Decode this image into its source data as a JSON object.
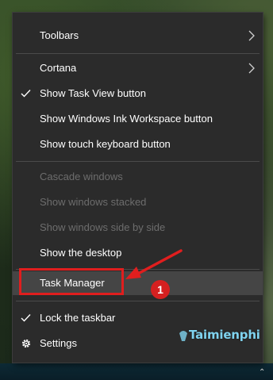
{
  "context_menu": {
    "items": [
      {
        "label": "Toolbars",
        "state": "enabled",
        "has_submenu": true
      },
      {
        "label": "Cortana",
        "state": "enabled",
        "has_submenu": true
      },
      {
        "label": "Show Task View button",
        "state": "enabled",
        "checked": true
      },
      {
        "label": "Show Windows Ink Workspace button",
        "state": "enabled"
      },
      {
        "label": "Show touch keyboard button",
        "state": "enabled"
      },
      {
        "label": "Cascade windows",
        "state": "disabled"
      },
      {
        "label": "Show windows stacked",
        "state": "disabled"
      },
      {
        "label": "Show windows side by side",
        "state": "disabled"
      },
      {
        "label": "Show the desktop",
        "state": "enabled"
      },
      {
        "label": "Task Manager",
        "state": "hovered"
      },
      {
        "label": "Lock the taskbar",
        "state": "enabled",
        "checked": true
      },
      {
        "label": "Settings",
        "state": "enabled",
        "icon": "gear-icon"
      }
    ]
  },
  "annotation": {
    "step_number": "1",
    "highlight_color": "#e01e1e"
  },
  "watermark": {
    "text": "Taimienphi"
  },
  "colors": {
    "menu_background": "#2b2b2b",
    "hover_background": "#454545",
    "text": "#ffffff",
    "disabled_text": "#6d6d6d"
  }
}
